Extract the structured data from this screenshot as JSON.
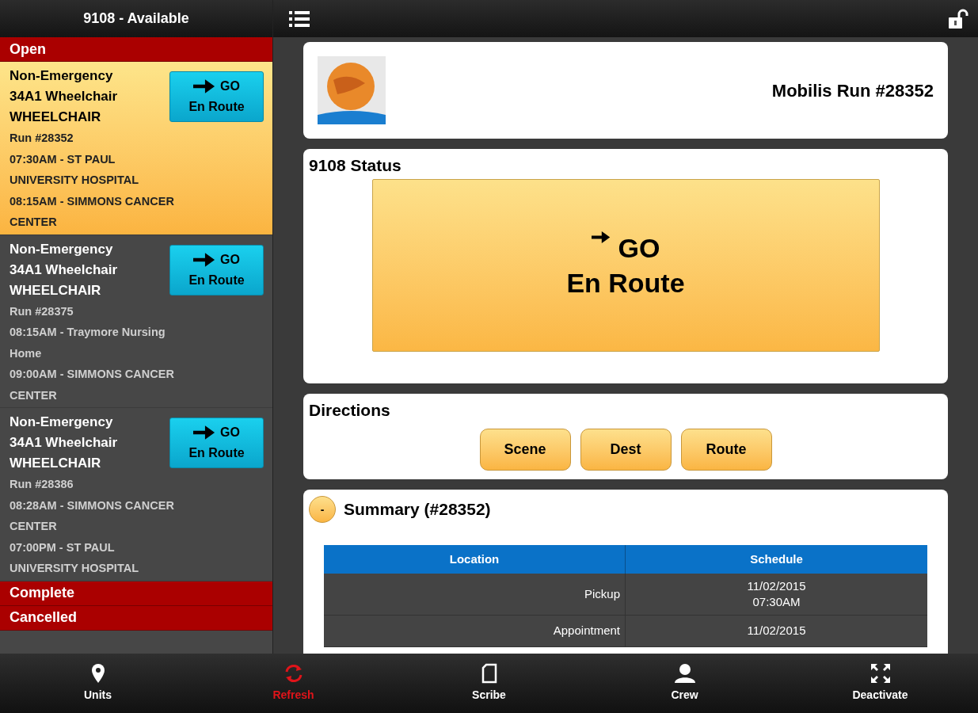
{
  "header": {
    "title": "9108 - Available"
  },
  "sidebar": {
    "sections": [
      {
        "label": "Open",
        "runs": [
          {
            "selected": true,
            "title_lines": [
              "Non-Emergency",
              "34A1 Wheelchair",
              "WHEELCHAIR"
            ],
            "detail_lines": [
              "Run #28352",
              "07:30AM - ST PAUL",
              "UNIVERSITY HOSPITAL",
              "08:15AM - SIMMONS CANCER",
              "CENTER"
            ],
            "button": [
              "GO",
              "En Route"
            ]
          },
          {
            "selected": false,
            "title_lines": [
              "Non-Emergency",
              "34A1 Wheelchair",
              "WHEELCHAIR"
            ],
            "detail_lines": [
              "Run #28375",
              "08:15AM - Traymore Nursing",
              "Home",
              "09:00AM - SIMMONS CANCER",
              "CENTER"
            ],
            "button": [
              "GO",
              "En Route"
            ]
          },
          {
            "selected": false,
            "title_lines": [
              "Non-Emergency",
              "34A1 Wheelchair",
              "WHEELCHAIR"
            ],
            "detail_lines": [
              "Run #28386",
              "08:28AM - SIMMONS CANCER",
              "CENTER",
              "07:00PM - ST PAUL",
              "UNIVERSITY HOSPITAL"
            ],
            "button": [
              "GO",
              "En Route"
            ]
          }
        ]
      },
      {
        "label": "Complete"
      },
      {
        "label": "Cancelled"
      }
    ]
  },
  "run_card": {
    "title": "Mobilis Run #28352"
  },
  "status": {
    "title": "9108 Status",
    "button": [
      "GO",
      "En Route"
    ]
  },
  "directions": {
    "title": "Directions",
    "buttons": [
      "Scene",
      "Dest",
      "Route"
    ]
  },
  "summary": {
    "toggle": "-",
    "title": "Summary (#28352)",
    "columns": [
      "Location",
      "Schedule"
    ],
    "rows": [
      {
        "location": "Pickup",
        "schedule": [
          "11/02/2015",
          "07:30AM"
        ]
      },
      {
        "location": "Appointment",
        "schedule": [
          "11/02/2015"
        ]
      }
    ]
  },
  "tabs": [
    {
      "kind": "pin",
      "label": "Units",
      "selected": false
    },
    {
      "kind": "refresh",
      "label": "Refresh",
      "selected": true
    },
    {
      "kind": "document",
      "label": "Scribe",
      "selected": false
    },
    {
      "kind": "person",
      "label": "Crew",
      "selected": false
    },
    {
      "kind": "expand",
      "label": "Deactivate",
      "selected": false
    }
  ]
}
